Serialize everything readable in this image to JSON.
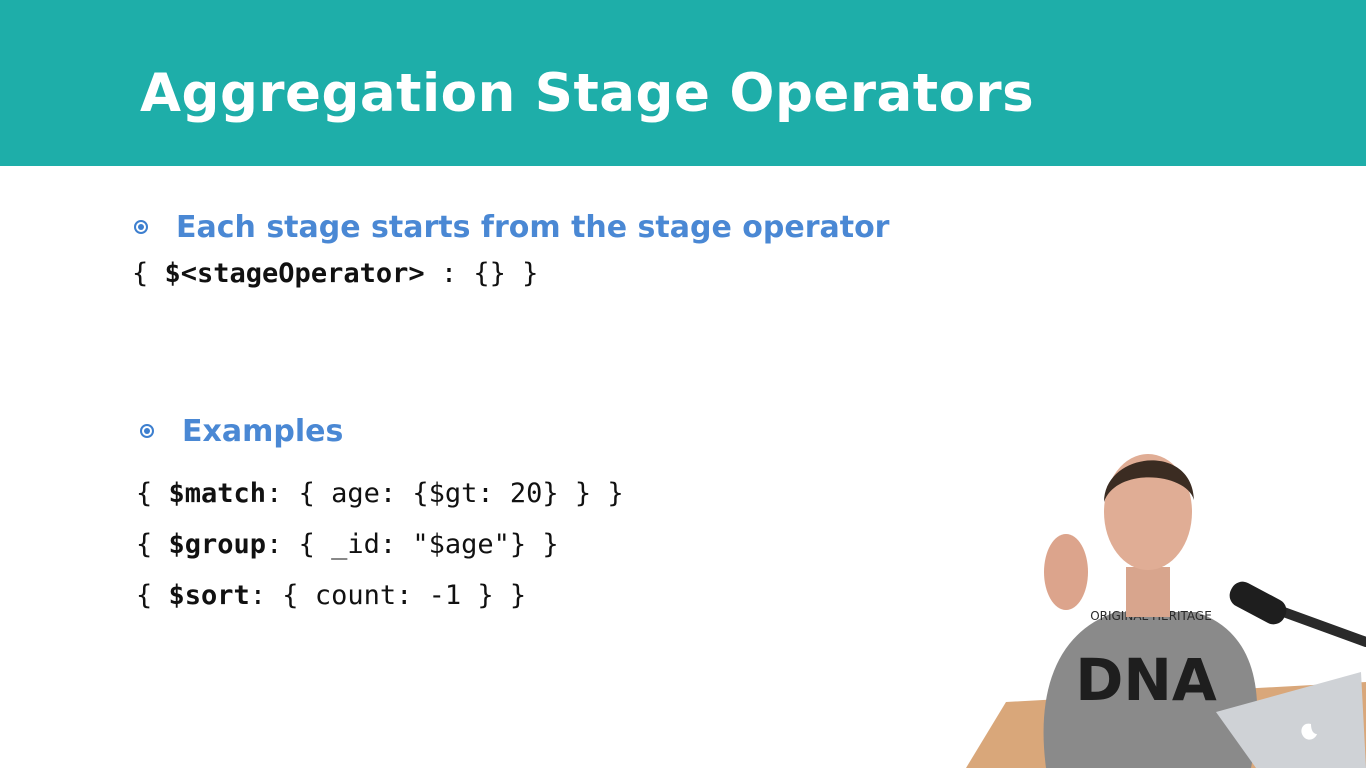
{
  "slide": {
    "title": "Aggregation Stage Operators"
  },
  "section1": {
    "bullet": "Each stage starts from the stage operator",
    "code": {
      "open": "{ ",
      "operator": "$<stageOperator>",
      "rest": " : {} }"
    }
  },
  "section2": {
    "bullet": "Examples",
    "lines": [
      {
        "open": "{ ",
        "operator": "$match",
        "rest": ": { age: {$gt: 20} } }"
      },
      {
        "open": "{ ",
        "operator": "$group",
        "rest": ": { _id: \"$age\"} }"
      },
      {
        "open": "{ ",
        "operator": "$sort",
        "rest": ": { count: -1 } }"
      }
    ]
  },
  "presenter": {
    "shirt_text": "ORIGINAL HERITAGE",
    "shirt_big": "DNA"
  },
  "colors": {
    "header": "#1eaea9",
    "bullet": "#4a88d4",
    "code": "#111111"
  }
}
